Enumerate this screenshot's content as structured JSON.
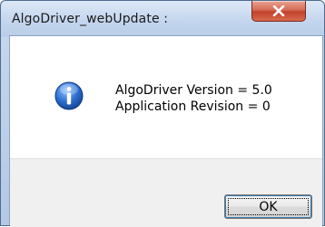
{
  "window": {
    "title": "AlgoDriver_webUpdate :",
    "close_icon": "close-icon"
  },
  "message": {
    "icon": "info-icon",
    "line1": "AlgoDriver Version = 5.0",
    "line2": "Application Revision = 0"
  },
  "buttons": {
    "ok_label": "OK"
  },
  "colors": {
    "titlebar": "#c4d6ee",
    "close_button": "#c2432c",
    "info_icon": "#2b64c5",
    "footer": "#f0f0f0"
  }
}
